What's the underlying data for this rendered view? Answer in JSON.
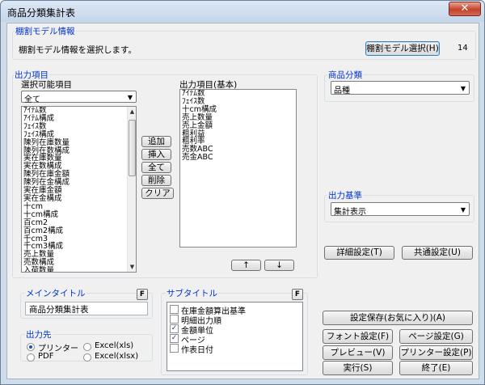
{
  "window": {
    "title": "商品分類集計表",
    "close_glyph": "✕"
  },
  "shelf_model": {
    "group_label": "棚割モデル情報",
    "prompt": "棚割モデル情報を選択します。",
    "select_button": "棚割モデル選択(H)",
    "count": "14"
  },
  "output_items": {
    "group_label": "出力項目",
    "available_label": "選択可能項目",
    "filter_value": "全て",
    "available_items": [
      "ｱｲﾃﾑ数",
      "ｱｲﾃﾑ構成",
      "ﾌｪｲｽ数",
      "ﾌｪｲｽ構成",
      "陳列在庫数量",
      "陳列在数構成",
      "実在庫数量",
      "実在数構成",
      "陳列在庫金額",
      "陳列在金構成",
      "実在庫金額",
      "実在金構成",
      "十cm",
      "十cm構成",
      "百cm2",
      "百cm2構成",
      "千cm3",
      "千cm3構成",
      "売上数量",
      "売数構成",
      "入荷数量"
    ],
    "selected_label": "出力項目(基本)",
    "selected_items": [
      "ｱｲﾃﾑ数",
      "ﾌｪｲｽ数",
      "十cm構成",
      "売上数量",
      "売上金額",
      "粗利益",
      "粗利率",
      "売数ABC",
      "売金ABC"
    ],
    "buttons": {
      "add": "追加",
      "insert": "挿入",
      "all": "全て",
      "delete": "削除",
      "clear": "クリア",
      "move_up": "↑",
      "move_down": "↓"
    }
  },
  "category": {
    "group_label": "商品分類",
    "value": "品種"
  },
  "output_basis": {
    "group_label": "出力基準",
    "value": "集計表示"
  },
  "settings_buttons": {
    "detail": "詳細設定(T)",
    "common": "共通設定(U)"
  },
  "main_title": {
    "group_label": "メインタイトル",
    "f_label": "F",
    "value": "商品分類集計表"
  },
  "sub_title": {
    "group_label": "サブタイトル",
    "f_label": "F",
    "items": [
      {
        "label": "在庫金額算出基準",
        "checked": false
      },
      {
        "label": "明細出力順",
        "checked": false
      },
      {
        "label": "金額単位",
        "checked": true
      },
      {
        "label": "ページ",
        "checked": true
      },
      {
        "label": "作表日付",
        "checked": false
      }
    ]
  },
  "destination": {
    "group_label": "出力先",
    "options": [
      {
        "label": "プリンター",
        "selected": true
      },
      {
        "label": "Excel(xls)",
        "selected": false
      },
      {
        "label": "PDF",
        "selected": false
      },
      {
        "label": "Excel(xlsx)",
        "selected": false
      }
    ]
  },
  "actions": {
    "save_favorite": "設定保存(お気に入り)(A)",
    "font_settings": "フォント設定(F)",
    "page_settings": "ページ設定(G)",
    "preview": "プレビュー(V)",
    "printer_settings": "プリンター設定(P)",
    "execute": "実行(S)",
    "exit": "終了(E)"
  },
  "glyphs": {
    "dropdown_arrow": "▼",
    "scroll_up": "▲",
    "scroll_down": "▼",
    "check": "✓"
  }
}
